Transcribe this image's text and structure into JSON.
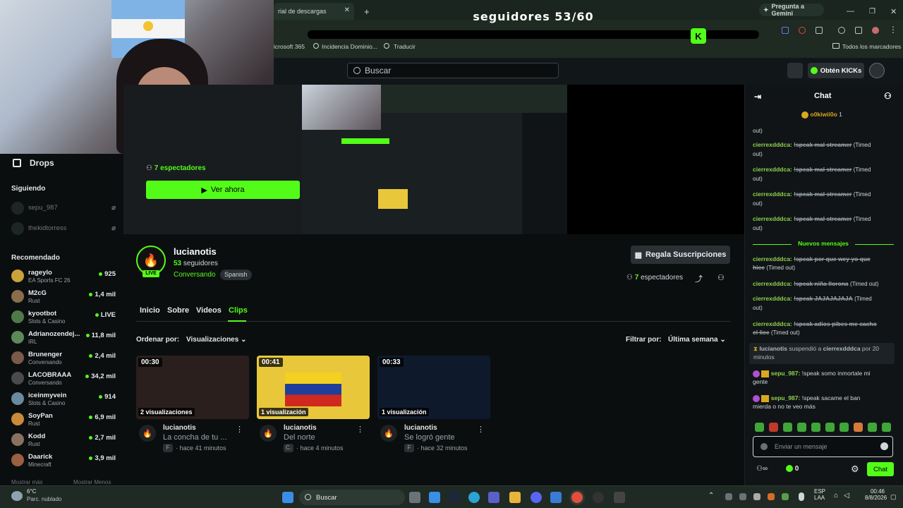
{
  "browser": {
    "tab_title": "rial de descargas",
    "gemini_label": "Pregunta a Gemini",
    "overlay_title": "seguidores 53/60",
    "overlay_logo": "K",
    "followers_progress": 0.883,
    "bookmarks": [
      "icrosoft 365",
      "Incidencia Dominio...",
      "Traducir"
    ],
    "all_bookmarks": "Todos los marcadores"
  },
  "header": {
    "search_placeholder": "Buscar",
    "kicks_label": "Obtén KICKs"
  },
  "sidebar": {
    "drops_label": "Drops",
    "following_title": "Siguiendo",
    "following": [
      {
        "name": "sepu_987"
      },
      {
        "name": "thekidtorress"
      }
    ],
    "recommended_title": "Recomendado",
    "recommended": [
      {
        "name": "rageylo",
        "category": "EA Sports FC 26",
        "viewers": "925"
      },
      {
        "name": "M2cG",
        "category": "Rust",
        "viewers": "1,4 mil"
      },
      {
        "name": "kyootbot",
        "category": "Slots & Casino",
        "viewers": "LIVE"
      },
      {
        "name": "Adrianozendej...",
        "category": "IRL",
        "viewers": "11,8 mil"
      },
      {
        "name": "Brunenger",
        "category": "Conversando",
        "viewers": "2,4 mil"
      },
      {
        "name": "LACOBRAAA",
        "category": "Conversando",
        "viewers": "34,2 mil"
      },
      {
        "name": "iceinmyvein",
        "category": "Slots & Casino",
        "viewers": "914"
      },
      {
        "name": "SoyPan",
        "category": "Rust",
        "viewers": "6,9 mil"
      },
      {
        "name": "Kodd",
        "category": "Rust",
        "viewers": "2,7 mil"
      },
      {
        "name": "Daarick",
        "category": "Minecraft",
        "viewers": "3,9 mil"
      }
    ],
    "show_more": "Mostrar más",
    "show_less": "Mostrar Menos"
  },
  "offline": {
    "viewers": "7 espectadores",
    "watch_label": "Ver ahora"
  },
  "channel": {
    "name": "lucianotis",
    "followers_count": "53",
    "followers_label": "seguidores",
    "category": "Conversando",
    "language": "Spanish",
    "live_badge": "LIVE",
    "gift_label": "Regala Suscripciones",
    "viewers": "7",
    "viewers_label": "espectadores"
  },
  "tabs": [
    {
      "label": "Inicio"
    },
    {
      "label": "Sobre"
    },
    {
      "label": "Videos"
    },
    {
      "label": "Clips"
    }
  ],
  "filters": {
    "sort_label": "Ordenar por:",
    "sort_value": "Visualizaciones",
    "filter_label": "Filtrar por:",
    "filter_value": "Última semana"
  },
  "clips": [
    {
      "duration": "00:30",
      "views": "2 visualizaciones",
      "channel": "lucianotis",
      "title": "La concha de tu ...",
      "initial": "F",
      "time": "· hace 41 minutos",
      "color": "#2a1f1d"
    },
    {
      "duration": "00:41",
      "views": "1 visualización",
      "channel": "lucianotis",
      "title": "Del norte",
      "initial": "C.",
      "time": "· hace 4 minutos",
      "color": "#e8c83a"
    },
    {
      "duration": "00:33",
      "views": "1 visualización",
      "channel": "lucianotis",
      "title": "Se logró gente",
      "initial": "F",
      "time": "· hace 32 minutos",
      "color": "#0e1a2c"
    }
  ],
  "chat": {
    "title": "Chat",
    "top_user": "o0kiwii0o",
    "top_count": "1",
    "timed_out": "(Timed out)",
    "first_out": "out)",
    "messages_old": [
      {
        "user": "cierrexdddca:",
        "text": "!speak mal streamer",
        "suffix": "(Timed",
        "suffix2": "out)"
      },
      {
        "user": "cierrexdddca:",
        "text": "!speak mal streamer",
        "suffix": "(Timed",
        "suffix2": "out)"
      },
      {
        "user": "cierrexdddca:",
        "text": "!speak mal streamer",
        "suffix": "(Timed",
        "suffix2": "out)"
      },
      {
        "user": "cierrexdddca:",
        "text": "!speak mal streamer",
        "suffix": "(Timed",
        "suffix2": "out)"
      }
    ],
    "new_messages": "Nuevos mensajes",
    "messages_new": [
      {
        "user": "cierrexdddca:",
        "text": "!speak por que wey yo que",
        "text2": "hice",
        "suffix": "(Timed out)"
      },
      {
        "user": "cierrexdddca:",
        "text": "!speak niña llorona",
        "suffix": "(Timed out)"
      },
      {
        "user": "cierrexdddca:",
        "text": "!speak JAJAJAJAJA",
        "suffix": "(Timed",
        "suffix2": "out)"
      },
      {
        "user": "cierrexdddca:",
        "text": "!speak adios pibes me cacho",
        "text2": "el lice",
        "suffix": "(Timed out)"
      }
    ],
    "system": {
      "mod": "lucianotis",
      "action": "suspendió a",
      "target": "cierrexdddca",
      "duration": "por 20",
      "duration2": "minutos"
    },
    "user_messages": [
      {
        "user": "sepu_987:",
        "text": "!speak somo inmortale mi",
        "text2": "gente"
      },
      {
        "user": "sepu_987:",
        "text": "!speak sacame el ban",
        "text2": "mierda o no te veo más"
      }
    ],
    "input_placeholder": "Enviar un mensaje",
    "kicks_count": "0",
    "send_label": "Chat"
  },
  "taskbar": {
    "temperature": "6°C",
    "weather": "Parc. nublado",
    "search_label": "Buscar",
    "lang": "ESP",
    "lang2": "LAA",
    "time": "00:46",
    "date": "8/8/2026"
  },
  "colors": {
    "accent": "#53fc18",
    "bg": "#0b0e0f",
    "panel": "#101416"
  }
}
